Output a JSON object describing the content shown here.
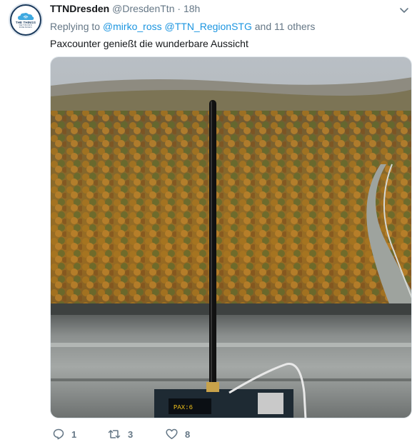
{
  "tweet": {
    "display_name": "TTNDresden",
    "handle": "@DresdenTtn",
    "separator": "·",
    "time": "18h",
    "reply": {
      "prefix": "Replying to",
      "mention_1": "@mirko_ross",
      "mention_2": "@TTN_RegionSTG",
      "suffix": "and 11 others"
    },
    "text": "Paxcounter genießt die wunderbare Aussicht",
    "avatar": {
      "line1": "THE THINGS",
      "line2": "NETWORK",
      "line3": "DRESDEN"
    },
    "device_display_text": "PAX:6"
  },
  "actions": {
    "reply_count": "1",
    "retweet_count": "3",
    "like_count": "8"
  },
  "icons": {
    "reply": "reply-icon",
    "retweet": "retweet-icon",
    "like": "heart-icon",
    "menu": "chevron-down-icon"
  },
  "colors": {
    "link": "#1b95e0",
    "secondary_text": "#657786",
    "primary_text": "#14171a"
  }
}
